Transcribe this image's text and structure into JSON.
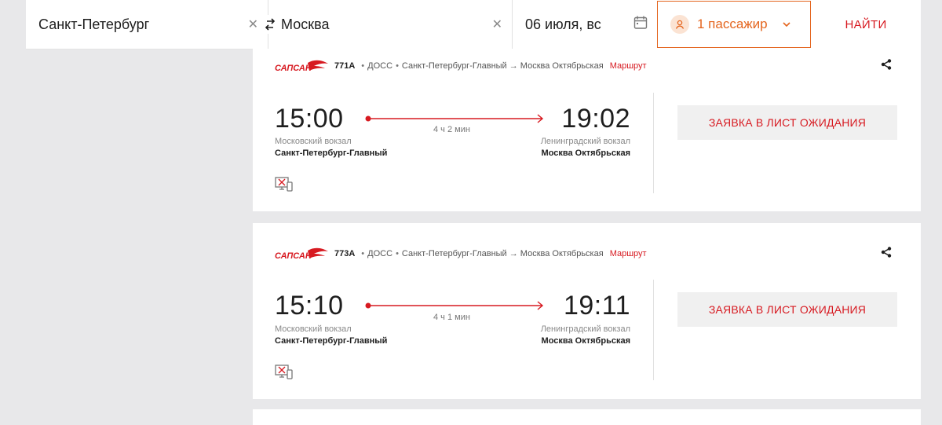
{
  "search": {
    "from": "Санкт-Петербург",
    "to": "Москва",
    "date": "06 июля, вс",
    "passengers": "1 пассажир",
    "find_label": "НАЙТИ",
    "clear_icon": "close-icon",
    "swap_icon": "swap-icon",
    "calendar_icon": "calendar-icon",
    "accent_color": "#e4651e"
  },
  "trains": [
    {
      "brand": "САПСАН",
      "number": "771А",
      "carrier": "ДОСС",
      "route_text": "Санкт-Петербург-Главный → Москва Октябрьская",
      "route_link": "Маршрут",
      "departure_time": "15:00",
      "arrival_time": "19:02",
      "duration": "4 ч 2 мин",
      "departure_station": "Московский вокзал",
      "departure_city": "Санкт-Петербург-Главный",
      "arrival_station": "Ленинградский вокзал",
      "arrival_city": "Москва Октябрьская",
      "action_label": "ЗАЯВКА В ЛИСТ ОЖИДАНИЯ"
    },
    {
      "brand": "САПСАН",
      "number": "773А",
      "carrier": "ДОСС",
      "route_text": "Санкт-Петербург-Главный → Москва Октябрьская",
      "route_link": "Маршрут",
      "departure_time": "15:10",
      "arrival_time": "19:11",
      "duration": "4 ч 1 мин",
      "departure_station": "Московский вокзал",
      "departure_city": "Санкт-Петербург-Главный",
      "arrival_station": "Ленинградский вокзал",
      "arrival_city": "Москва Октябрьская",
      "action_label": "ЗАЯВКА В ЛИСТ ОЖИДАНИЯ"
    }
  ],
  "colors": {
    "brand_red": "#d71a21",
    "background": "#e8e8ea"
  }
}
